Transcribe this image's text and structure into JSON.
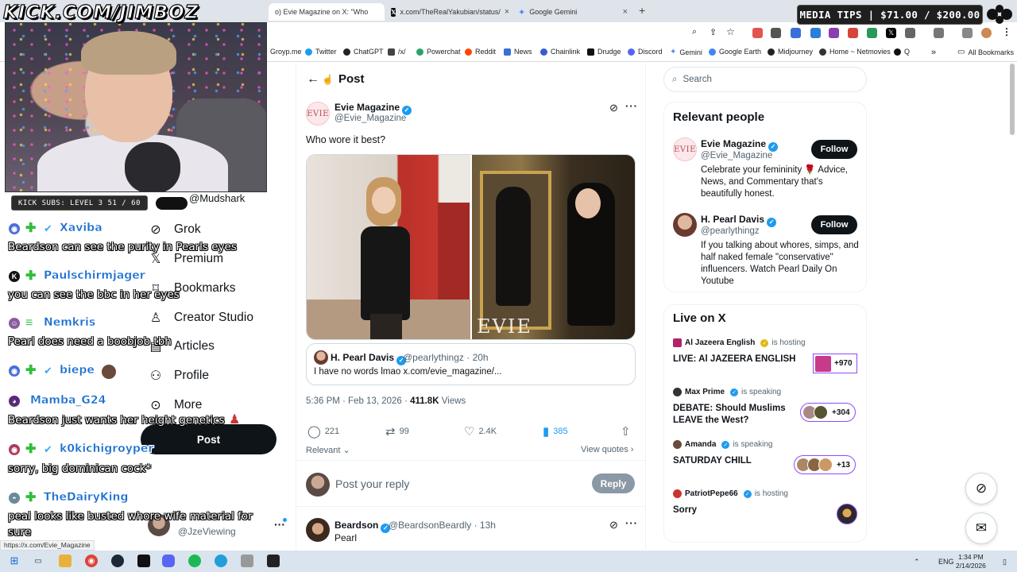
{
  "overlay": {
    "url": "KICK.COM/JIMBOZ",
    "subs": "KICK SUBS: LEVEL 3 51 / 60",
    "media_tips": "MEDIA TIPS | $71.00 / $200.00"
  },
  "browser": {
    "tabs": [
      {
        "title": "o) Evie Magazine on X: \"Who",
        "icon": "x-logo-icon",
        "close": "×"
      },
      {
        "title": "x.com/TheRealYakubian/status/",
        "icon": "x-logo-icon",
        "close": "×"
      },
      {
        "title": "Google Gemini",
        "icon": "gemini-icon",
        "close": "×"
      }
    ],
    "new_tab": "+",
    "bookmarks": [
      "Groyp.me",
      "Twitter",
      "ChatGPT",
      "/x/",
      "Powerchat",
      "Reddit",
      "News",
      "Chainlink",
      "Drudge",
      "Discord",
      "Gemini",
      "Google Earth",
      "Midjourney",
      "Home ~ Netmovies",
      "Q"
    ],
    "more_bookmarks": "»",
    "all_bookmarks": "All Bookmarks",
    "status_url": "https://x.com/Evie_Magazine"
  },
  "chat": [
    {
      "user": "Xaviba",
      "msg": "Beardson can see the purity in Pearls eyes"
    },
    {
      "user": "Paulschirmjager",
      "msg": "you can see the bbc in her eyes"
    },
    {
      "user": "Nemkris",
      "msg": "Pearl does need a boobjob tbh"
    },
    {
      "user": "biepe",
      "msg": ""
    },
    {
      "user": "Mamba_G24",
      "msg": "Beardson just wants her height genetics"
    },
    {
      "user": "k0kichigroyper",
      "msg": "sorry, big dominican cock*"
    },
    {
      "user": "TheDairyKing",
      "msg": "peal looks like busted whore wife material for",
      "msg2": "sure"
    }
  ],
  "x_nav": {
    "partial_item": "@Mudshark",
    "items": [
      {
        "label": "Grok",
        "icon": "grok-icon"
      },
      {
        "label": "Premium",
        "icon": "x-logo-icon"
      },
      {
        "label": "Bookmarks",
        "icon": "bookmark-icon"
      },
      {
        "label": "Creator Studio",
        "icon": "creator-studio-icon"
      },
      {
        "label": "Articles",
        "icon": "articles-icon"
      },
      {
        "label": "Profile",
        "icon": "profile-icon"
      },
      {
        "label": "More",
        "icon": "more-circle-icon"
      }
    ],
    "post_button": "Post",
    "account_handle": "@JzeViewing",
    "account_more": "···"
  },
  "post": {
    "page_title": "Post",
    "back": "←",
    "author": {
      "name": "Evie Magazine",
      "handle": "@Evie_Magazine",
      "avatar_text": "EVIE"
    },
    "text": "Who wore it best?",
    "media_watermark": "EVIE",
    "quote": {
      "name": "H. Pearl Davis",
      "handle": "@pearlythingz",
      "time": "· 20h",
      "text": "I have no words lmao x.com/evie_magazine/..."
    },
    "meta": {
      "time": "5:36 PM · Feb 13, 2026 ·",
      "views": "411.8K",
      "views_label": "Views"
    },
    "actions": {
      "replies": "221",
      "reposts": "99",
      "likes": "2.4K",
      "bookmarks": "385"
    },
    "sort_label": "Relevant",
    "view_quotes": "View quotes ›",
    "reply_placeholder": "Post your reply",
    "reply_button": "Reply",
    "first_reply": {
      "name": "Beardson",
      "handle": "@BeardsonBeardly",
      "time": "· 13h",
      "text": "Pearl"
    }
  },
  "sidebar": {
    "search_placeholder": "Search",
    "relevant_title": "Relevant people",
    "people": [
      {
        "name": "Evie Magazine",
        "handle": "@Evie_Magazine",
        "bio": "Celebrate your femininity 🌹 Advice, News, and Commentary that's beautifully honest.",
        "follow": "Follow",
        "avatar_text": "EVIE"
      },
      {
        "name": "H. Pearl Davis",
        "handle": "@pearlythingz",
        "bio": "If you talking about whores, simps, and half naked female \"conservative\" influencers. Watch Pearl Daily On Youtube",
        "follow": "Follow"
      }
    ],
    "live_title": "Live on X",
    "live": [
      {
        "host": "Al Jazeera English",
        "status": "is hosting",
        "title": "LIVE: Al JAZEERA ENGLISH",
        "count": "+970"
      },
      {
        "host": "Max Prime",
        "status": "is speaking",
        "title": "DEBATE: Should Muslims LEAVE the West?",
        "count": "+304"
      },
      {
        "host": "Amanda",
        "status": "is speaking",
        "title": "SATURDAY CHILL",
        "count": "+13"
      },
      {
        "host": "PatriotPepe66",
        "status": "is hosting",
        "title": "Sorry",
        "count": ""
      }
    ]
  },
  "taskbar": {
    "lang": "ENG",
    "time": "1:34 PM",
    "date": "2/14/2026"
  }
}
